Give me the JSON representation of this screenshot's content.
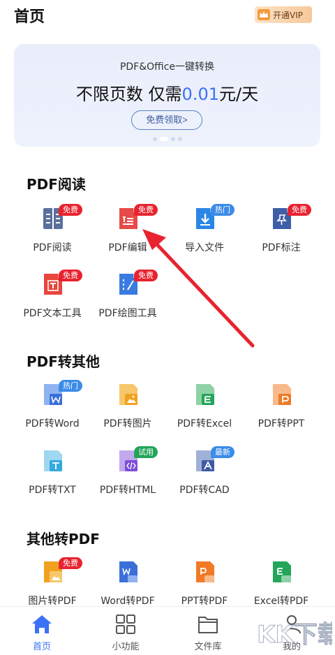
{
  "header": {
    "title": "首页",
    "vip_label": "开通VIP"
  },
  "banner": {
    "subtitle": "PDF&Office一键转换",
    "main_prefix": "不限页数 仅需",
    "main_highlight": "0.01",
    "main_suffix": "元/天",
    "button_label": "免费领取>"
  },
  "sections": {
    "pdf_read": {
      "title": "PDF阅读",
      "items": [
        {
          "label": "PDF阅读",
          "badge": "免费",
          "icon": "book-icon"
        },
        {
          "label": "PDF编辑",
          "badge": "免费",
          "icon": "edit-doc-icon"
        },
        {
          "label": "导入文件",
          "badge": "热门",
          "icon": "import-icon"
        },
        {
          "label": "PDF标注",
          "badge": "免费",
          "icon": "pin-icon"
        },
        {
          "label": "PDF文本工具",
          "badge": "免费",
          "icon": "text-tool-icon"
        },
        {
          "label": "PDF绘图工具",
          "badge": "免费",
          "icon": "draw-tool-icon"
        }
      ]
    },
    "pdf_to_other": {
      "title": "PDF转其他",
      "items": [
        {
          "label": "PDF转Word",
          "badge": "热门",
          "icon": "word-icon"
        },
        {
          "label": "PDF转图片",
          "badge": "",
          "icon": "image-icon"
        },
        {
          "label": "PDF转Excel",
          "badge": "",
          "icon": "excel-icon"
        },
        {
          "label": "PDF转PPT",
          "badge": "",
          "icon": "ppt-icon"
        },
        {
          "label": "PDF转TXT",
          "badge": "",
          "icon": "txt-icon"
        },
        {
          "label": "PDF转HTML",
          "badge": "试用",
          "icon": "html-icon"
        },
        {
          "label": "PDF转CAD",
          "badge": "最新",
          "icon": "cad-icon"
        }
      ]
    },
    "other_to_pdf": {
      "title": "其他转PDF",
      "items": [
        {
          "label": "图片转PDF",
          "badge": "免费",
          "icon": "image-icon"
        },
        {
          "label": "Word转PDF",
          "badge": "",
          "icon": "word-icon"
        },
        {
          "label": "PPT转PDF",
          "badge": "",
          "icon": "ppt-icon"
        },
        {
          "label": "Excel转PDF",
          "badge": "",
          "icon": "excel-icon"
        }
      ]
    }
  },
  "tabbar": {
    "items": [
      {
        "label": "首页",
        "icon": "home-icon"
      },
      {
        "label": "小功能",
        "icon": "grid-icon"
      },
      {
        "label": "文件库",
        "icon": "folder-icon"
      },
      {
        "label": "我的",
        "icon": "user-icon"
      }
    ]
  },
  "watermark": {
    "text": "KK下载"
  },
  "colors": {
    "accent": "#3a72f5",
    "badge_red": "#e8232f",
    "badge_blue": "#3b8be8",
    "badge_green": "#22a55a",
    "arrow": "#e8232f"
  }
}
